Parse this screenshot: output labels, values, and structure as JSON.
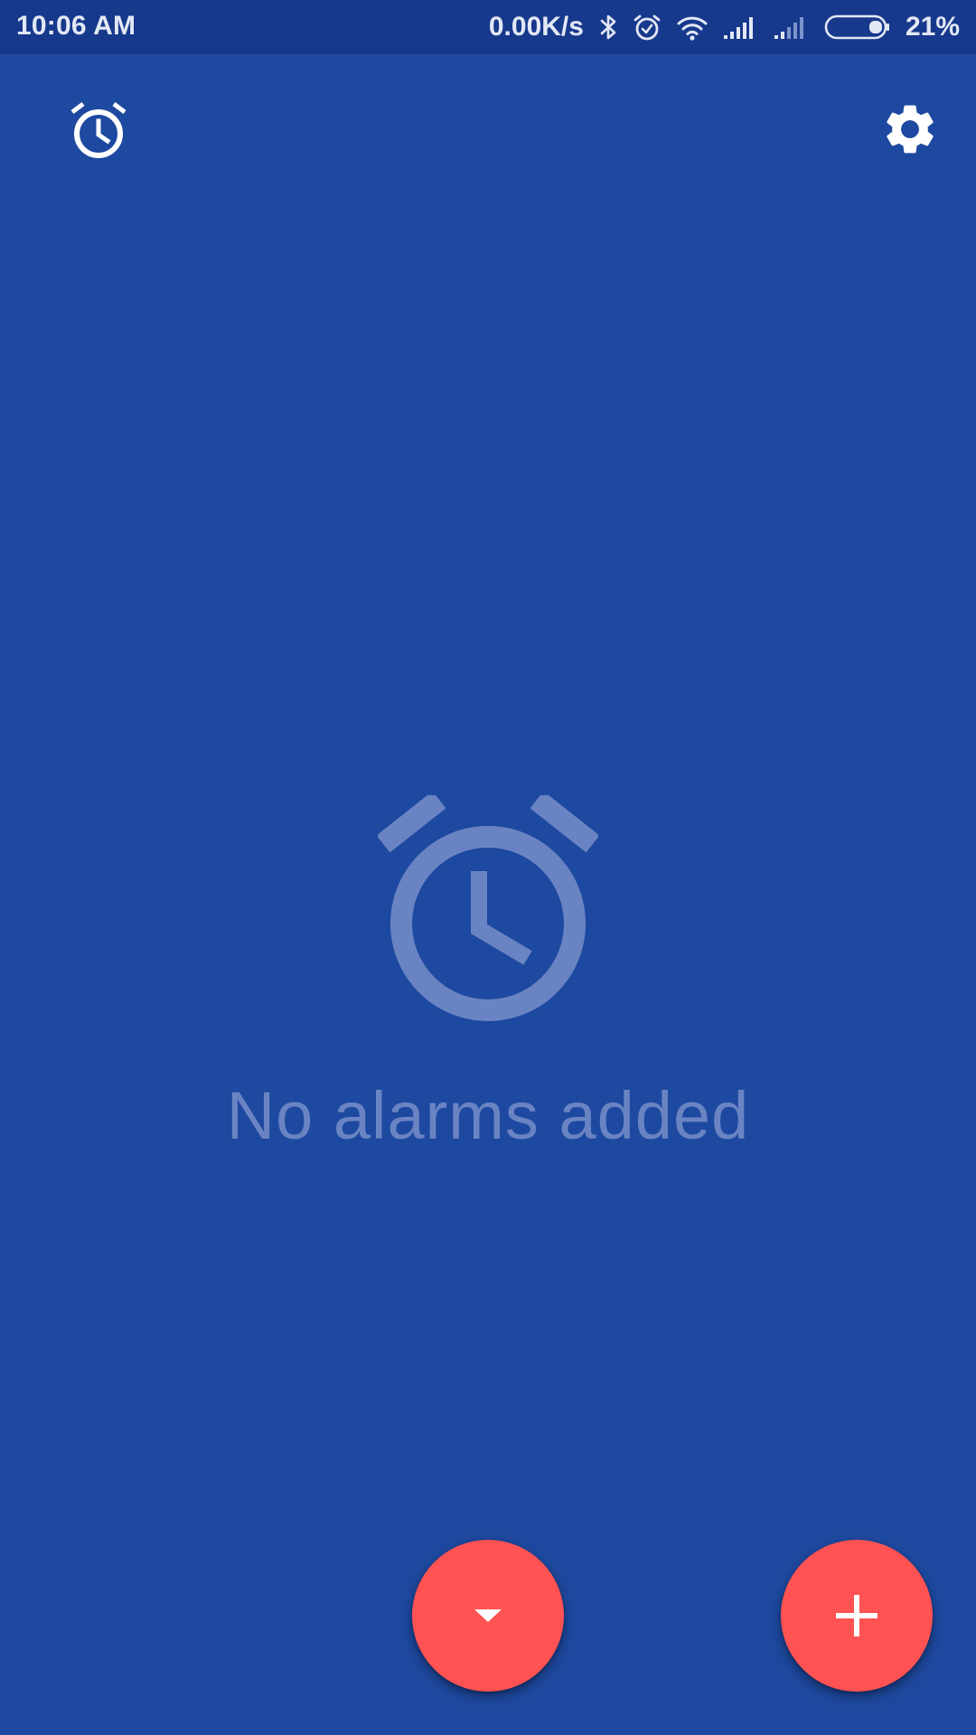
{
  "status_bar": {
    "time": "10:06 AM",
    "net_speed": "0.00K/s",
    "battery_percent": "21%",
    "battery_level": 0.21,
    "icons": [
      "bluetooth-icon",
      "alarm-icon",
      "wifi-icon",
      "signal-icon",
      "signal-icon",
      "battery-icon"
    ]
  },
  "toolbar": {
    "left_icon": "alarm-clock-icon",
    "right_icon": "settings-gear-icon"
  },
  "empty_state": {
    "icon": "alarm-clock-icon",
    "message": "No alarms added"
  },
  "fabs": {
    "collapse_icon": "caret-down-icon",
    "add_icon": "plus-icon"
  },
  "colors": {
    "background": "#1E49A0",
    "status_bar": "#17398C",
    "fab": "#FF5252",
    "empty_muted": "#6A84C3"
  }
}
